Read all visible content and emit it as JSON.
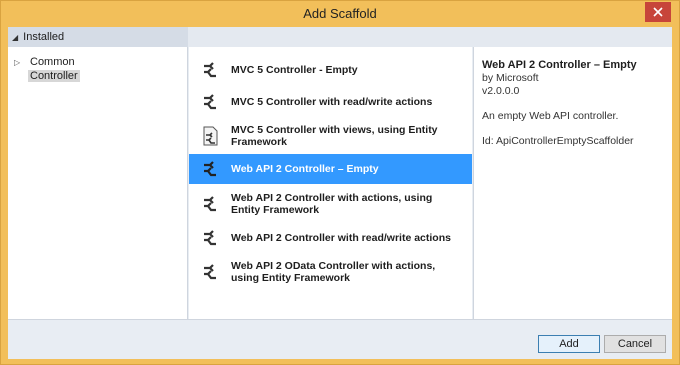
{
  "window": {
    "title": "Add Scaffold"
  },
  "left_pane": {
    "header": "Installed",
    "tree": [
      {
        "label": "Common",
        "selected": false
      },
      {
        "label": "Controller",
        "selected": true
      }
    ]
  },
  "templates": [
    {
      "label": "MVC 5 Controller - Empty",
      "icon": "controller-icon",
      "selected": false
    },
    {
      "label": "MVC 5 Controller with read/write actions",
      "icon": "controller-icon",
      "selected": false
    },
    {
      "label": "MVC 5 Controller with views, using Entity Framework",
      "icon": "controller-views-icon",
      "selected": false
    },
    {
      "label": "Web API 2 Controller – Empty",
      "icon": "controller-icon",
      "selected": true
    },
    {
      "label": "Web API 2 Controller with actions, using Entity Framework",
      "icon": "controller-icon",
      "selected": false
    },
    {
      "label": "Web API 2 Controller with read/write actions",
      "icon": "controller-icon",
      "selected": false
    },
    {
      "label": "Web API 2 OData Controller with actions, using Entity Framework",
      "icon": "controller-icon",
      "selected": false
    }
  ],
  "details": {
    "title": "Web API 2 Controller – Empty",
    "author": "by Microsoft",
    "version": "v2.0.0.0",
    "description": "An empty Web API controller.",
    "id": "Id: ApiControllerEmptyScaffolder"
  },
  "buttons": {
    "add": "Add",
    "cancel": "Cancel"
  },
  "colors": {
    "selection": "#3399ff",
    "frame": "#f2bf5a",
    "close": "#c7453a"
  }
}
